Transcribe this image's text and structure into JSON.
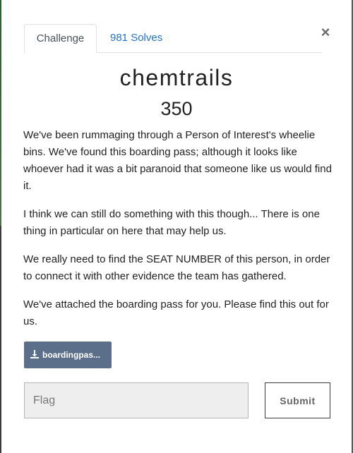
{
  "tabs": {
    "challenge": "Challenge",
    "solves": "981 Solves"
  },
  "close_label": "×",
  "challenge": {
    "name": "chemtrails",
    "value": "350",
    "description": [
      "We've been rummaging through a Person of Interest's wheelie bins. We've found this boarding pass; although it looks like whoever had it was a bit paranoid that someone like us would find it.",
      "I think we can still do something with this though... There is one thing in particular on here that may help us.",
      "We really need to find the SEAT NUMBER of this person, in order to connect it with other evidence the team has gathered.",
      "We've attached the boarding pass for you. Please find this out for us."
    ]
  },
  "file": {
    "label": "boardingpas...",
    "icon": "download-icon"
  },
  "flag": {
    "placeholder": "Flag",
    "value": ""
  },
  "submit_label": "Submit",
  "colors": {
    "tab_link": "#2573c8",
    "file_button": "#5b6e8a",
    "input_bg": "#eeeeee"
  }
}
